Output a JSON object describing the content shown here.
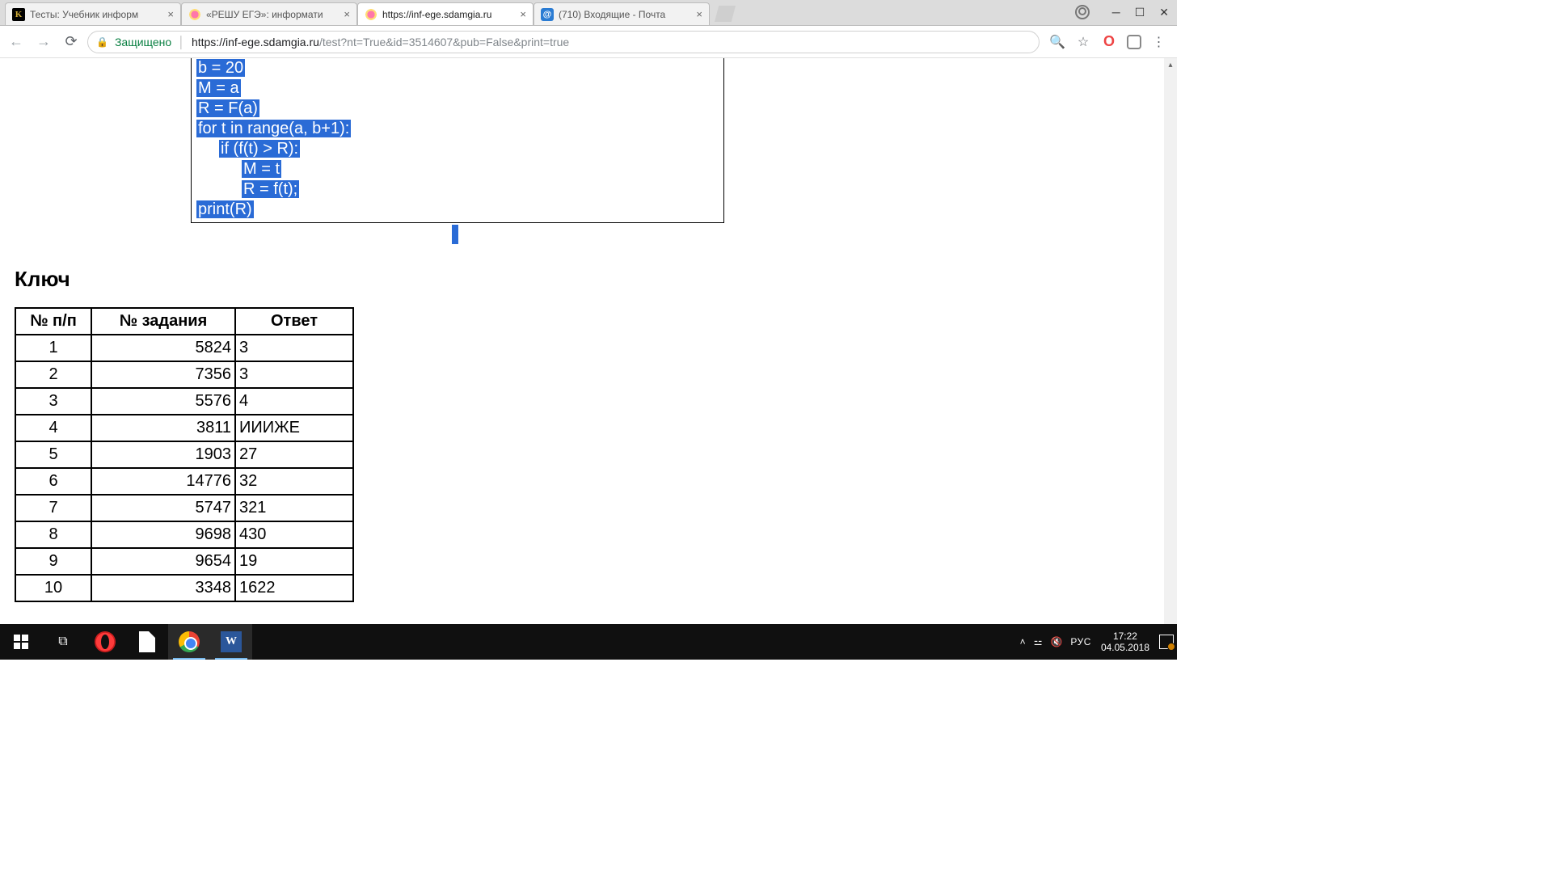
{
  "tabs": [
    {
      "title": "Тесты: Учебник информ",
      "icon": "k"
    },
    {
      "title": "«РЕШУ ЕГЭ»: информати",
      "icon": "reshu"
    },
    {
      "title": "https://inf-ege.sdamgia.ru",
      "icon": "reshu",
      "active": true
    },
    {
      "title": "(710) Входящие - Почта",
      "icon": "mail"
    }
  ],
  "address": {
    "secure_label": "Защищено",
    "url_host": "https://inf-ege.sdamgia.ru",
    "url_path": "/test?nt=True&id=3514607&pub=False&print=true"
  },
  "code_lines": [
    {
      "indent": 0,
      "text": "b = 20"
    },
    {
      "indent": 0,
      "text": "M = a"
    },
    {
      "indent": 0,
      "text": "R = F(a)"
    },
    {
      "indent": 0,
      "text": "for t in range(a, b+1):"
    },
    {
      "indent": 1,
      "text": "if (f(t) > R):"
    },
    {
      "indent": 2,
      "text": "M = t"
    },
    {
      "indent": 2,
      "text": "R = f(t);"
    },
    {
      "indent": 0,
      "text": "print(R)"
    }
  ],
  "key_heading": "Ключ",
  "table": {
    "headers": [
      "№ п/п",
      "№ задания",
      "Ответ"
    ],
    "rows": [
      [
        "1",
        "5824",
        "3"
      ],
      [
        "2",
        "7356",
        "3"
      ],
      [
        "3",
        "5576",
        "4"
      ],
      [
        "4",
        "3811",
        "ИИИЖЕ"
      ],
      [
        "5",
        "1903",
        "27"
      ],
      [
        "6",
        "14776",
        "32"
      ],
      [
        "7",
        "5747",
        "321"
      ],
      [
        "8",
        "9698",
        "430"
      ],
      [
        "9",
        "9654",
        "19"
      ],
      [
        "10",
        "3348",
        "1622"
      ]
    ]
  },
  "taskbar": {
    "lang": "РУС",
    "time": "17:22",
    "date": "04.05.2018"
  }
}
